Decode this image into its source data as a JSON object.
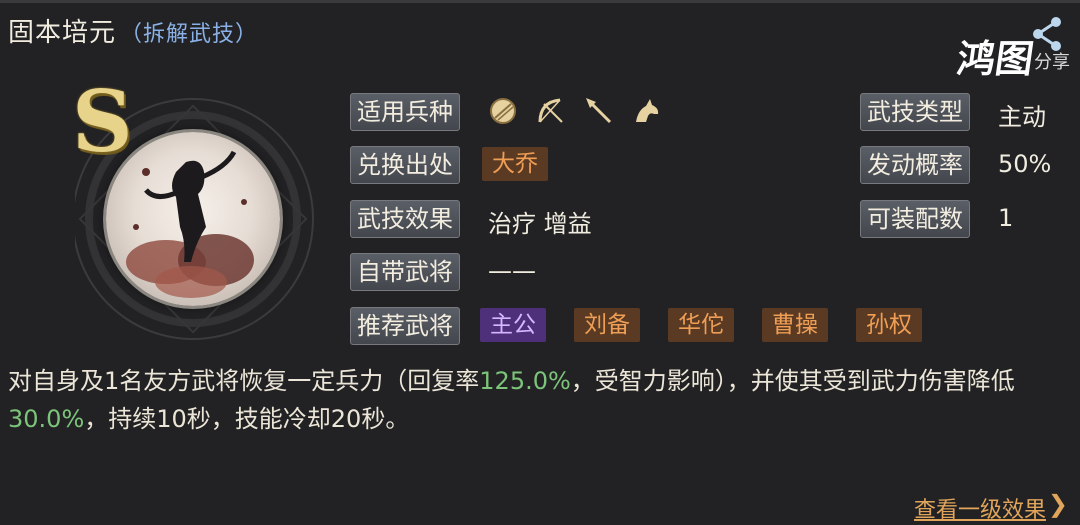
{
  "header": {
    "title": "固本培元",
    "subtitle": "（拆解武技）"
  },
  "watermark": {
    "brand": "鸿图",
    "share": "分享"
  },
  "skill": {
    "grade": "S"
  },
  "rows": {
    "troop_label": "适用兵种",
    "source_label": "兑换出处",
    "source_tag": "大乔",
    "effect_label": "武技效果",
    "effect_value": "治疗 增益",
    "own_general_label": "自带武将",
    "own_general_value": "——",
    "recommend_label": "推荐武将",
    "recommend_tags": [
      "主公",
      "刘备",
      "华佗",
      "曹操",
      "孙权"
    ]
  },
  "troop_icons": [
    "shield-icon",
    "bow-icon",
    "spear-icon",
    "horse-icon"
  ],
  "stats": {
    "type_label": "武技类型",
    "type_value": "主动",
    "prob_label": "发动概率",
    "prob_value": "50%",
    "slots_label": "可装配数",
    "slots_value": "1"
  },
  "description": {
    "p1": "对自身及1名友方武将恢复一定兵力（回复率",
    "v1": "125.0%",
    "p2": "，受智力影响），并使其受到武力伤害降低",
    "v2": "30.0%",
    "p3": "，持续10秒，技能冷却20秒。"
  },
  "footer": {
    "link": "查看一级效果",
    "arrow": "❯"
  },
  "colors": {
    "accent_green": "#7cc47a",
    "tag_brown_text": "#ee9e55",
    "tag_purple_bg": "#4d2f7a",
    "link": "#e0a45a"
  }
}
